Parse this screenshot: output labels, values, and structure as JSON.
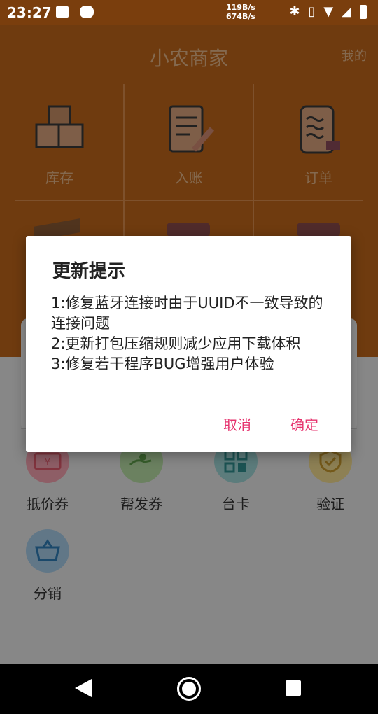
{
  "status_bar": {
    "time": "23:27",
    "net_up": "119B/s",
    "net_down": "674B/s"
  },
  "header": {
    "title": "小农商家",
    "mine": "我的"
  },
  "grid": [
    {
      "label": "库存",
      "icon": "boxes-icon"
    },
    {
      "label": "入账",
      "icon": "notebook-pen-icon"
    },
    {
      "label": "订单",
      "icon": "receipt-cart-icon"
    }
  ],
  "services": [
    {
      "label": "抵价券",
      "icon": "coupon-icon",
      "color": "#f5a3b0"
    },
    {
      "label": "帮发券",
      "icon": "hand-money-icon",
      "color": "#b8dfa6"
    },
    {
      "label": "台卡",
      "icon": "qr-card-icon",
      "color": "#9fd6d6"
    },
    {
      "label": "验证",
      "icon": "shield-check-icon",
      "color": "#f3dc92"
    },
    {
      "label": "分销",
      "icon": "basket-icon",
      "color": "#a7cde8"
    }
  ],
  "dialog": {
    "title": "更新提示",
    "lines": [
      "1:修复蓝牙连接时由于UUID不一致导致的连接问题",
      "2:更新打包压缩规则减少应用下载体积",
      "3:修复若干程序BUG增强用户体验"
    ],
    "cancel": "取消",
    "confirm": "确定"
  }
}
